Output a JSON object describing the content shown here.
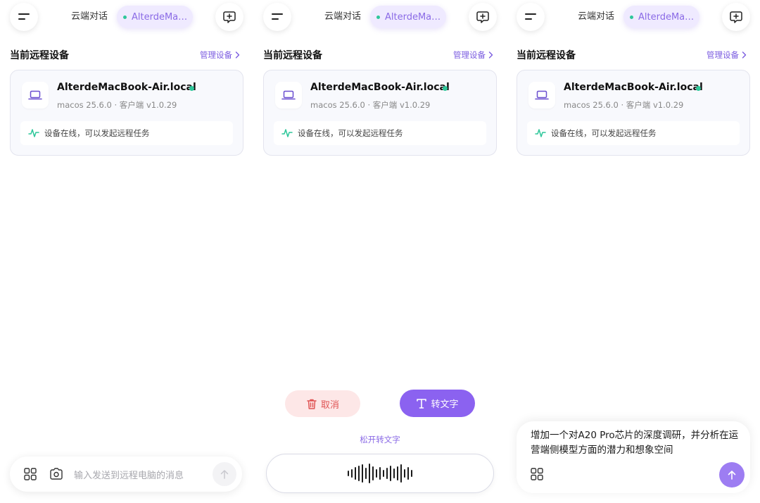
{
  "tabs": {
    "cloud": "云端对话",
    "remote": "AlterdeMacBook-Air.local"
  },
  "section": {
    "title": "当前远程设备",
    "manage": "管理设备"
  },
  "device": {
    "name": "AlterdeMacBook-Air.local",
    "meta": "macos 25.6.0 · 客户端 v1.0.29",
    "status": "设备在线，可以发起远程任务",
    "online": true
  },
  "input": {
    "placeholder": "输入发送到远程电脑的消息"
  },
  "voice": {
    "cancel": "取消",
    "to_text": "转文字",
    "release_hint": "松开转文字"
  },
  "compose": {
    "text": "增加一个对A20 Pro芯片的深度调研，并分析在运营端侧模型方面的潜力和想象空间"
  },
  "colors": {
    "accent": "#8b62f0",
    "online": "#2ec79a",
    "danger": "#e05555"
  },
  "icons": [
    "menu-icon",
    "new-chat-icon",
    "laptop-icon",
    "pulse-icon",
    "apps-icon",
    "camera-icon",
    "send-arrow-icon",
    "trash-icon",
    "text-icon",
    "chevron-right-icon"
  ]
}
